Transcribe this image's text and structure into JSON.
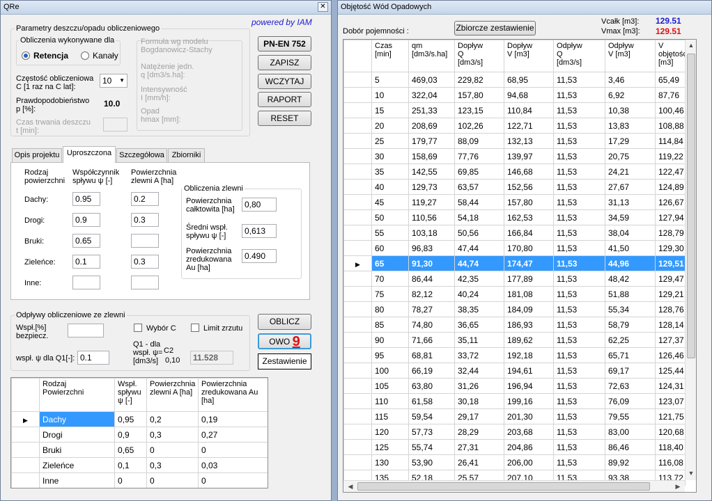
{
  "left": {
    "title": "QRe",
    "powered": "powered by IAM",
    "rain_group": "Parametry deszczu/opadu obliczeniowego",
    "calc_group": "Obliczenia wykonywane dla",
    "radio_retencja": "Retencja",
    "radio_kanaly": "Kanały",
    "czestosc_label": "Częstość obliczeniowa\nC [1 raz na  C lat]:",
    "czestosc_value": "10",
    "prawdop_label": "Prawdopodobieństwo\np [%]:",
    "prawdop_value": "10.0",
    "czas_label": "Czas trwania deszczu\nt [min]:",
    "formula_label": "Formuła wg  modelu\nBogdanowicz-Stachy",
    "natezenie_label": "Natężenie jedn.\nq [dm3/s.ha]:",
    "intensywnosc_label": "Intensywność\nI [mm/h]:",
    "opad_label": "Opad\nhmax [mm]:",
    "btn_pn": "PN-EN 752",
    "btn_zapisz": "ZAPISZ",
    "btn_wczytaj": "WCZYTAJ",
    "btn_raport": "RAPORT",
    "btn_reset": "RESET",
    "tabs": [
      "Opis projektu",
      "Uproszczona",
      "Szczegółowa",
      "Zbiorniki"
    ],
    "col_rodzaj": "Rodzaj\npowierzchni",
    "col_wsp": "Współczynnik\nspływu ψ [-]",
    "col_pow": "Powierzchnia\nzlewni A [ha]",
    "surfaces": [
      {
        "name": "Dachy:",
        "wsp": "0.95",
        "pow": "0.2"
      },
      {
        "name": "Drogi:",
        "wsp": "0.9",
        "pow": "0.3"
      },
      {
        "name": "Bruki:",
        "wsp": "0.65",
        "pow": ""
      },
      {
        "name": "Zieleńce:",
        "wsp": "0.1",
        "pow": "0.3"
      },
      {
        "name": "Inne:",
        "wsp": "",
        "pow": ""
      }
    ],
    "obl_group": "Obliczenia zlewni",
    "pow_calk_label": "Powierzchnia\ncałktowita [ha]",
    "pow_calk_value": "0,80",
    "sredni_label": "Średni wspł.\nspływu ψ [-]",
    "sredni_value": "0,613",
    "zred_label": "Powierzchnia\nzredukowana\nAu [ha]",
    "zred_value": "0.490",
    "odplywy_group": "Odpływy obliczeniowe ze zlewni",
    "wspl_label": "Wspł.[%]\nbezpiecz.",
    "wyborc_label": "Wybór C",
    "limit_label": "Limit zrzutu",
    "q1_label": "Q1 -  dla\nwspł. ψ=\n[dm3/s]",
    "c2_label": "C2",
    "c2_value": "0,10",
    "q1_value": "11.528",
    "wsp_q1_label": "wspł. ψ dla Q1[-]:",
    "wsp_q1_value": "0.1",
    "btn_oblicz": "OBLICZ",
    "btn_owo": "OWO",
    "owo_badge": "9",
    "btn_zestawienie": "Zestawienie",
    "grid_headers": [
      "Rodzaj\nPowierzchni",
      "Wspł.\nspływu\nψ [-]",
      "Powierzchnia\nzlewni A [ha]",
      "Powierzchnia\nzredukowana Au\n[ha]"
    ],
    "grid_rows": [
      [
        "Dachy",
        "0,95",
        "0,2",
        "0,19"
      ],
      [
        "Drogi",
        "0,9",
        "0,3",
        "0,27"
      ],
      [
        "Bruki",
        "0,65",
        "0",
        "0"
      ],
      [
        "Zieleńce",
        "0,1",
        "0,3",
        "0,03"
      ],
      [
        "Inne",
        "0",
        "0",
        "0"
      ]
    ]
  },
  "right": {
    "title": "Objętość Wód Opadowych",
    "dobor_label": "Dobór pojemności :",
    "zbiorcze_btn": "Zbiorcze zestawienie",
    "vcalk_label": "Vcałk [m3]:",
    "vcalk_value": "129.51",
    "vmax_label": "Vmax [m3]:",
    "vmax_value": "129.51",
    "vcalk_color": "#1b1bd0",
    "vmax_color": "#e01010",
    "selected_color": "#3399ff",
    "selected_row": 12,
    "headers": [
      "Czas\n[min]",
      "qm\n[dm3/s.ha]",
      "Dopływ\nQ\n[dm3/s]",
      "Dopływ\nV [m3]",
      "Odpływ\nQ\n[dm3/s]",
      "Odpływ\nV [m3]",
      "V\nobjętość\n[m3]"
    ],
    "rows": [
      [
        "5",
        "469,03",
        "229,82",
        "68,95",
        "11,53",
        "3,46",
        "65,49"
      ],
      [
        "10",
        "322,04",
        "157,80",
        "94,68",
        "11,53",
        "6,92",
        "87,76"
      ],
      [
        "15",
        "251,33",
        "123,15",
        "110,84",
        "11,53",
        "10,38",
        "100,46"
      ],
      [
        "20",
        "208,69",
        "102,26",
        "122,71",
        "11,53",
        "13,83",
        "108,88"
      ],
      [
        "25",
        "179,77",
        "88,09",
        "132,13",
        "11,53",
        "17,29",
        "114,84"
      ],
      [
        "30",
        "158,69",
        "77,76",
        "139,97",
        "11,53",
        "20,75",
        "119,22"
      ],
      [
        "35",
        "142,55",
        "69,85",
        "146,68",
        "11,53",
        "24,21",
        "122,47"
      ],
      [
        "40",
        "129,73",
        "63,57",
        "152,56",
        "11,53",
        "27,67",
        "124,89"
      ],
      [
        "45",
        "119,27",
        "58,44",
        "157,80",
        "11,53",
        "31,13",
        "126,67"
      ],
      [
        "50",
        "110,56",
        "54,18",
        "162,53",
        "11,53",
        "34,59",
        "127,94"
      ],
      [
        "55",
        "103,18",
        "50,56",
        "166,84",
        "11,53",
        "38,04",
        "128,79"
      ],
      [
        "60",
        "96,83",
        "47,44",
        "170,80",
        "11,53",
        "41,50",
        "129,30"
      ],
      [
        "65",
        "91,30",
        "44,74",
        "174,47",
        "11,53",
        "44,96",
        "129,51"
      ],
      [
        "70",
        "86,44",
        "42,35",
        "177,89",
        "11,53",
        "48,42",
        "129,47"
      ],
      [
        "75",
        "82,12",
        "40,24",
        "181,08",
        "11,53",
        "51,88",
        "129,21"
      ],
      [
        "80",
        "78,27",
        "38,35",
        "184,09",
        "11,53",
        "55,34",
        "128,76"
      ],
      [
        "85",
        "74,80",
        "36,65",
        "186,93",
        "11,53",
        "58,79",
        "128,14"
      ],
      [
        "90",
        "71,66",
        "35,11",
        "189,62",
        "11,53",
        "62,25",
        "127,37"
      ],
      [
        "95",
        "68,81",
        "33,72",
        "192,18",
        "11,53",
        "65,71",
        "126,46"
      ],
      [
        "100",
        "66,19",
        "32,44",
        "194,61",
        "11,53",
        "69,17",
        "125,44"
      ],
      [
        "105",
        "63,80",
        "31,26",
        "196,94",
        "11,53",
        "72,63",
        "124,31"
      ],
      [
        "110",
        "61,58",
        "30,18",
        "199,16",
        "11,53",
        "76,09",
        "123,07"
      ],
      [
        "115",
        "59,54",
        "29,17",
        "201,30",
        "11,53",
        "79,55",
        "121,75"
      ],
      [
        "120",
        "57,73",
        "28,29",
        "203,68",
        "11,53",
        "83,00",
        "120,68"
      ],
      [
        "125",
        "55,74",
        "27,31",
        "204,86",
        "11,53",
        "86,46",
        "118,40"
      ],
      [
        "130",
        "53,90",
        "26,41",
        "206,00",
        "11,53",
        "89,92",
        "116,08"
      ],
      [
        "135",
        "52,18",
        "25,57",
        "207,10",
        "11,53",
        "93,38",
        "113,72"
      ]
    ]
  }
}
